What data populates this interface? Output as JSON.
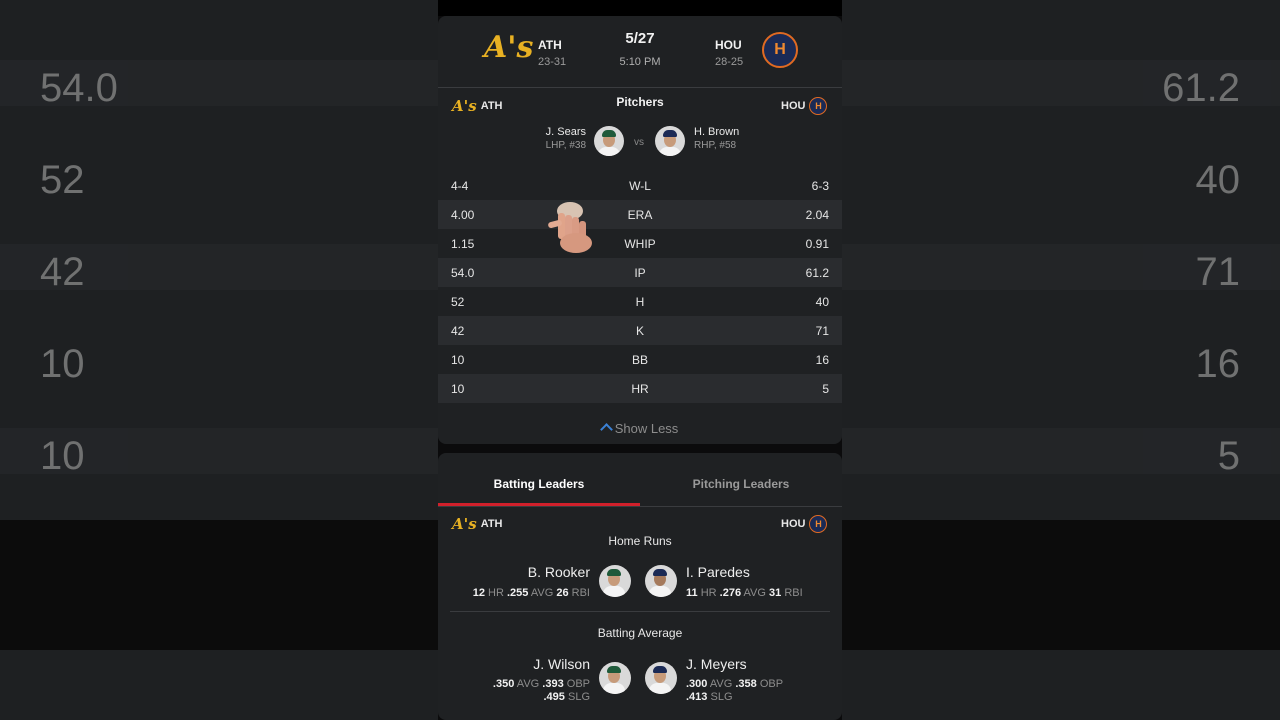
{
  "colors": {
    "accent_red": "#d1202b",
    "link_blue": "#3b82d6",
    "as_gold": "#e8b123",
    "astros_orange": "#e06a22"
  },
  "background": {
    "left_values": [
      "54.0",
      "52",
      "42",
      "10",
      "10"
    ],
    "right_values": [
      "61.2",
      "40",
      "71",
      "16",
      "5"
    ]
  },
  "header": {
    "away": {
      "abbr": "ATH",
      "record": "23-31",
      "logo": "A's",
      "logo_icon": "athletics-logo-icon"
    },
    "home": {
      "abbr": "HOU",
      "record": "28-25",
      "logo": "H",
      "logo_icon": "astros-logo-icon"
    },
    "date": "5/27",
    "time": "5:10 PM"
  },
  "pitchers": {
    "title": "Pitchers",
    "away_label": "ATH",
    "home_label": "HOU",
    "away": {
      "name": "J. Sears",
      "info": "LHP, #38"
    },
    "home": {
      "name": "H. Brown",
      "info": "RHP, #58"
    },
    "vs": "vs"
  },
  "stats": [
    {
      "away": "4-4",
      "label": "W-L",
      "home": "6-3"
    },
    {
      "away": "4.00",
      "label": "ERA",
      "home": "2.04"
    },
    {
      "away": "1.15",
      "label": "WHIP",
      "home": "0.91"
    },
    {
      "away": "54.0",
      "label": "IP",
      "home": "61.2"
    },
    {
      "away": "52",
      "label": "H",
      "home": "40"
    },
    {
      "away": "42",
      "label": "K",
      "home": "71"
    },
    {
      "away": "10",
      "label": "BB",
      "home": "16"
    },
    {
      "away": "10",
      "label": "HR",
      "home": "5"
    }
  ],
  "show_less": "Show Less",
  "tabs": {
    "batting": "Batting Leaders",
    "pitching": "Pitching Leaders"
  },
  "leaders": {
    "away_label": "ATH",
    "home_label": "HOU",
    "home_runs": {
      "title": "Home Runs",
      "away": {
        "name": "B. Rooker",
        "v1": "12",
        "u1": "HR",
        "v2": ".255",
        "u2": "AVG",
        "v3": "26",
        "u3": "RBI"
      },
      "home": {
        "name": "I. Paredes",
        "v1": "11",
        "u1": "HR",
        "v2": ".276",
        "u2": "AVG",
        "v3": "31",
        "u3": "RBI"
      }
    },
    "batting_average": {
      "title": "Batting Average",
      "away": {
        "name": "J. Wilson",
        "v1": ".350",
        "u1": "AVG",
        "v2": ".393",
        "u2": "OBP",
        "v3": ".495",
        "u3": "SLG"
      },
      "home": {
        "name": "J. Meyers",
        "v1": ".300",
        "u1": "AVG",
        "v2": ".358",
        "u2": "OBP",
        "v3": ".413",
        "u3": "SLG"
      }
    }
  }
}
